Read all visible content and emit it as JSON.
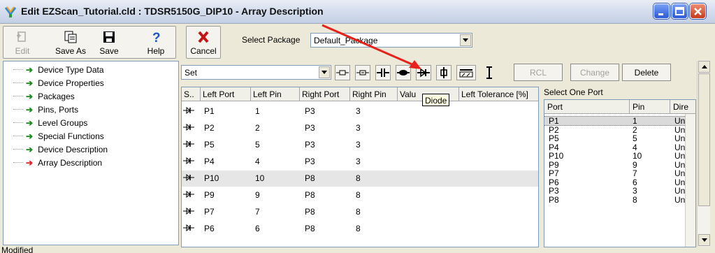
{
  "window": {
    "title": "Edit  EZScan_Tutorial.cld : TDSR5150G_DIP10 - Array Description",
    "controls": [
      "minimize-icon",
      "maximize-icon",
      "close-icon"
    ]
  },
  "toolbar": {
    "edit_label": "Edit",
    "save_as_label": "Save As",
    "save_label": "Save",
    "help_label": "Help",
    "cancel_label": "Cancel",
    "select_package_label": "Select Package",
    "select_package_value": "Default_Package"
  },
  "tree": {
    "items": [
      {
        "label": "Device Type Data",
        "arrow_color": "#1a8a1a"
      },
      {
        "label": "Device Properties",
        "arrow_color": "#1a8a1a"
      },
      {
        "label": "Packages",
        "arrow_color": "#1a8a1a"
      },
      {
        "label": "Pins, Ports",
        "arrow_color": "#1a8a1a"
      },
      {
        "label": "Level Groups",
        "arrow_color": "#1a8a1a"
      },
      {
        "label": "Special Functions",
        "arrow_color": "#1a8a1a"
      },
      {
        "label": "Device Description",
        "arrow_color": "#1a8a1a"
      },
      {
        "label": "Array Description",
        "arrow_color": "#e02020"
      }
    ]
  },
  "array": {
    "set_value": "Set",
    "component_icons": [
      "resistor-icon",
      "resistor-alt-icon",
      "capacitor-icon",
      "diode-led-icon",
      "diode-icon",
      "fuse-icon",
      "switch-icon",
      "ibeam-icon"
    ],
    "rcl_label": "RCL",
    "change_label": "Change",
    "delete_label": "Delete",
    "tooltip": "Diode",
    "columns": [
      "S..",
      "Left Port",
      "Left Pin",
      "Right Port",
      "Right Pin",
      "Valu",
      "Left Tolerance [%]"
    ],
    "rows": [
      {
        "left_port": "P1",
        "left_pin": "1",
        "right_port": "P3",
        "right_pin": "3"
      },
      {
        "left_port": "P2",
        "left_pin": "2",
        "right_port": "P3",
        "right_pin": "3"
      },
      {
        "left_port": "P5",
        "left_pin": "5",
        "right_port": "P3",
        "right_pin": "3"
      },
      {
        "left_port": "P4",
        "left_pin": "4",
        "right_port": "P3",
        "right_pin": "3"
      },
      {
        "left_port": "P10",
        "left_pin": "10",
        "right_port": "P8",
        "right_pin": "8"
      },
      {
        "left_port": "P9",
        "left_pin": "9",
        "right_port": "P8",
        "right_pin": "8"
      },
      {
        "left_port": "P7",
        "left_pin": "7",
        "right_port": "P8",
        "right_pin": "8"
      },
      {
        "left_port": "P6",
        "left_pin": "6",
        "right_port": "P8",
        "right_pin": "8"
      }
    ]
  },
  "port_select": {
    "title": "Select One Port",
    "columns": [
      "Port",
      "Pin",
      "Dire"
    ],
    "rows": [
      {
        "port": "P1",
        "pin": "1",
        "dir": "Unk"
      },
      {
        "port": "P2",
        "pin": "2",
        "dir": "Unk"
      },
      {
        "port": "P5",
        "pin": "5",
        "dir": "Unk"
      },
      {
        "port": "P4",
        "pin": "4",
        "dir": "Unk"
      },
      {
        "port": "P10",
        "pin": "10",
        "dir": "Unk"
      },
      {
        "port": "P9",
        "pin": "9",
        "dir": "Unk"
      },
      {
        "port": "P7",
        "pin": "7",
        "dir": "Unk"
      },
      {
        "port": "P6",
        "pin": "6",
        "dir": "Unk"
      },
      {
        "port": "P3",
        "pin": "3",
        "dir": "Unk"
      },
      {
        "port": "P8",
        "pin": "8",
        "dir": "Unk"
      }
    ]
  },
  "status": {
    "text": "Modified"
  },
  "colors": {
    "annotation_arrow": "#e8211b",
    "title_text": "#111111"
  }
}
